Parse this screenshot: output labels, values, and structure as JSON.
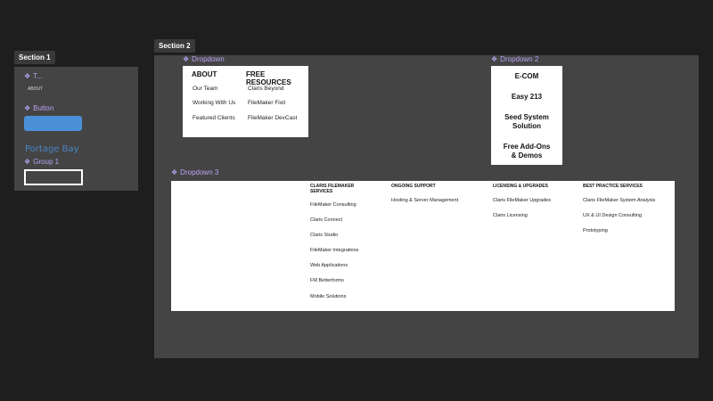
{
  "section1": {
    "tag": "Section 1",
    "text_component_label": "T...",
    "text_component_value": "ABOUT",
    "button_component_label": "Button",
    "logo_text": "Portage Bay",
    "group_label": "Group 1"
  },
  "section2": {
    "tag": "Section 2",
    "dropdown1": {
      "label": "Dropdown",
      "col1_heading": "ABOUT",
      "col1_items": [
        "Our Team",
        "Working With Us",
        "Featured Clients"
      ],
      "col2_heading": "FREE RESOURCES",
      "col2_items": [
        "Claris Beyond",
        "FileMaker Fixit",
        "FileMaker DevCast"
      ]
    },
    "dropdown2": {
      "label": "Dropdown 2",
      "items": [
        "E-COM",
        "Easy 213",
        "Seed System Solution",
        "Free Add-Ons & Demos"
      ]
    },
    "dropdown3": {
      "label": "Dropdown 3",
      "columns": [
        {
          "heading": "CLARIS FILEMAKER SERVICES",
          "items": [
            "FileMaker Consulting",
            "Claris Connect",
            "Claris Studio",
            "FileMaker Integrations",
            "Web Applications",
            "FM Betterforms",
            "Mobile Solutions"
          ]
        },
        {
          "heading": "ONGOING SUPPORT",
          "items": [
            "Hosting & Server Management"
          ]
        },
        {
          "heading": "LICENSING & UPGRADES",
          "items": [
            "Claris FileMaker Upgrades",
            "Claris Licensing"
          ]
        },
        {
          "heading": "BEST PRACTICE SERVICES",
          "items": [
            "Claris FileMaker System Analysis",
            "UX & UI Design Consulting",
            "Prototyping"
          ]
        }
      ]
    }
  },
  "icons": {
    "component": "component-diamond-icon"
  }
}
